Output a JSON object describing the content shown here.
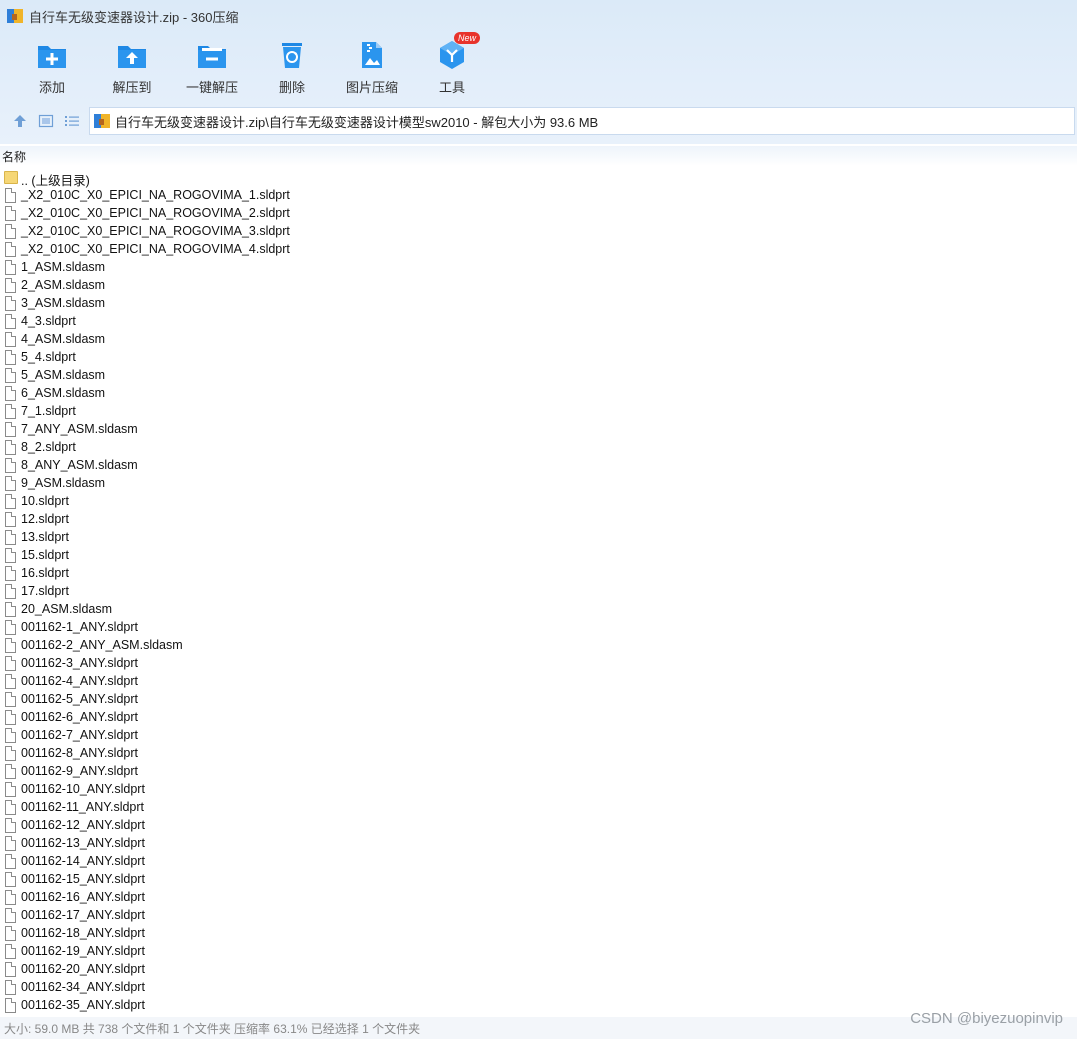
{
  "window": {
    "title": "自行车无级变速器设计.zip - 360压缩"
  },
  "toolbar": {
    "items": [
      {
        "label": "添加",
        "icon": "add-icon"
      },
      {
        "label": "解压到",
        "icon": "extract-to-icon"
      },
      {
        "label": "一键解压",
        "icon": "one-click-extract-icon"
      },
      {
        "label": "删除",
        "icon": "delete-icon"
      },
      {
        "label": "图片压缩",
        "icon": "image-compress-icon"
      },
      {
        "label": "工具",
        "icon": "tools-icon",
        "badge": "New"
      }
    ]
  },
  "navbar": {
    "path": "自行车无级变速器设计.zip\\自行车无级变速器设计模型sw2010 - 解包大小为 93.6 MB"
  },
  "list": {
    "column_name": "名称",
    "parent": ".. (上级目录)",
    "files": [
      "_X2_010C_X0_EPICI_NA_ROGOVIMA_1.sldprt",
      "_X2_010C_X0_EPICI_NA_ROGOVIMA_2.sldprt",
      "_X2_010C_X0_EPICI_NA_ROGOVIMA_3.sldprt",
      "_X2_010C_X0_EPICI_NA_ROGOVIMA_4.sldprt",
      "1_ASM.sldasm",
      "2_ASM.sldasm",
      "3_ASM.sldasm",
      "4_3.sldprt",
      "4_ASM.sldasm",
      "5_4.sldprt",
      "5_ASM.sldasm",
      "6_ASM.sldasm",
      "7_1.sldprt",
      "7_ANY_ASM.sldasm",
      "8_2.sldprt",
      "8_ANY_ASM.sldasm",
      "9_ASM.sldasm",
      "10.sldprt",
      "12.sldprt",
      "13.sldprt",
      "15.sldprt",
      "16.sldprt",
      "17.sldprt",
      "20_ASM.sldasm",
      "001162-1_ANY.sldprt",
      "001162-2_ANY_ASM.sldasm",
      "001162-3_ANY.sldprt",
      "001162-4_ANY.sldprt",
      "001162-5_ANY.sldprt",
      "001162-6_ANY.sldprt",
      "001162-7_ANY.sldprt",
      "001162-8_ANY.sldprt",
      "001162-9_ANY.sldprt",
      "001162-10_ANY.sldprt",
      "001162-11_ANY.sldprt",
      "001162-12_ANY.sldprt",
      "001162-13_ANY.sldprt",
      "001162-14_ANY.sldprt",
      "001162-15_ANY.sldprt",
      "001162-16_ANY.sldprt",
      "001162-17_ANY.sldprt",
      "001162-18_ANY.sldprt",
      "001162-19_ANY.sldprt",
      "001162-20_ANY.sldprt",
      "001162-34_ANY.sldprt",
      "001162-35_ANY.sldprt"
    ]
  },
  "status": {
    "text": "大小: 59.0 MB 共 738 个文件和 1 个文件夹 压缩率 63.1% 已经选择 1 个文件夹",
    "watermark": "CSDN @biyezuopinvip"
  },
  "colors": {
    "accent": "#1e88e5",
    "toolbar_bg": "#dbeaf8",
    "badge": "#e8332b"
  }
}
